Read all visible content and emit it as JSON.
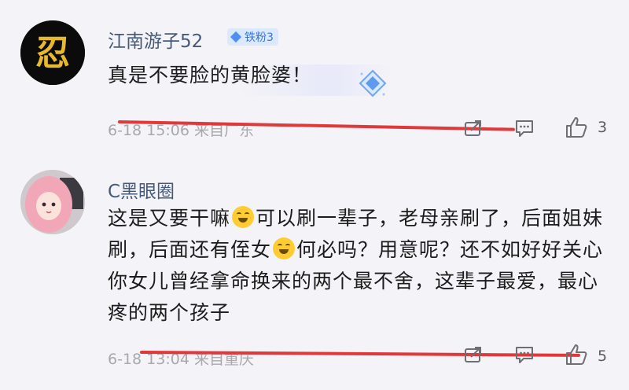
{
  "comments": [
    {
      "username": "江南游子52",
      "badge": "铁粉3",
      "text": "真是不要脸的黄脸婆！",
      "meta": "6-18 15:06 来自广东",
      "likes": "3",
      "avatar_glyph": "忍"
    },
    {
      "username": "C黑眼圈",
      "text_part1": "这是又要干嘛",
      "text_part2": "可以刷一辈子，老母亲刷了，后面姐妹刷，后面还有侄女",
      "text_part3": "何必吗？用意呢？还不如好好关心你女儿曾经拿命换来的两个最不舍，这辈子最爱，最心疼的两个孩子",
      "meta": "6-18 13:04 来自重庆",
      "likes": "5"
    }
  ],
  "icons": [
    "share-icon",
    "reply-icon",
    "like-icon",
    "laughing-emoji-icon",
    "diamond-sticker-icon"
  ],
  "colors": {
    "username": "#45597a",
    "badge_bg": "#dbe9ff",
    "badge_text": "#3975d9",
    "annotation_line": "#e0393b",
    "meta": "#a8a8ad"
  }
}
